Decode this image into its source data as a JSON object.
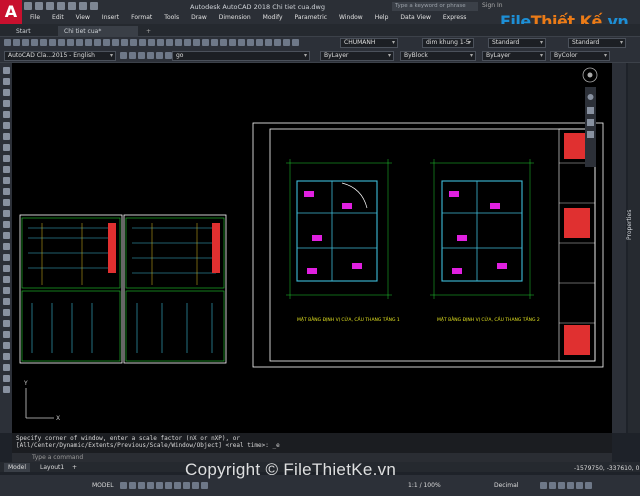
{
  "app": {
    "logo": "A",
    "window_title": "Autodesk AutoCAD 2018    Chi tiet cua.dwg",
    "search_placeholder": "Type a keyword or phrase",
    "signin": "Sign In"
  },
  "menu": [
    "File",
    "Edit",
    "View",
    "Insert",
    "Format",
    "Tools",
    "Draw",
    "Dimension",
    "Modify",
    "Parametric",
    "Window",
    "Help",
    "Data View",
    "Express"
  ],
  "brand": {
    "part1": "File",
    "part2": "Thiết Kế",
    "part3": ".vn"
  },
  "tabs": {
    "start": "Start",
    "doc": "Chi tiet cua*",
    "plus": "+"
  },
  "toolbar": {
    "layer": "CHUMANH",
    "dimstyle": "dim khung 1-5",
    "textstyle": "Standard",
    "tablestyle": "Standard",
    "workspace": "AutoCAD Cla...2015 - English",
    "layer2": "go",
    "color": "ByLayer",
    "linetype": "ByBlock",
    "lineweight": "ByLayer",
    "plotstyle": "ByColor"
  },
  "drawing": {
    "plan1_title": "MẶT BẰNG ĐỊNH VỊ CỬA, CẦU THANG TẦNG 1",
    "plan2_title": "MẶT BẰNG ĐỊNH VỊ CỬA, CẦU THANG TẦNG 2",
    "ucs_x": "X",
    "ucs_y": "Y"
  },
  "command": {
    "history_line1": "Specify corner of window, enter a scale factor (nX or nXP), or",
    "history_line2": "[All/Center/Dynamic/Extents/Previous/Scale/Window/Object] <real time>: _e",
    "prompt": "Type a command"
  },
  "layout_tabs": {
    "model": "Model",
    "layout1": "Layout1",
    "plus": "+"
  },
  "status": {
    "coords": "-1579750, -337610, 0",
    "model": "MODEL",
    "scale": "1:1 / 100%",
    "units": "Decimal"
  },
  "copyright": "Copyright © FileThietKe.vn",
  "properties_label": "Properties",
  "colors": {
    "accent_red": "#c8102e",
    "brand_blue": "#1d8fd6",
    "brand_orange": "#eb7b17",
    "canvas": "#000000"
  }
}
